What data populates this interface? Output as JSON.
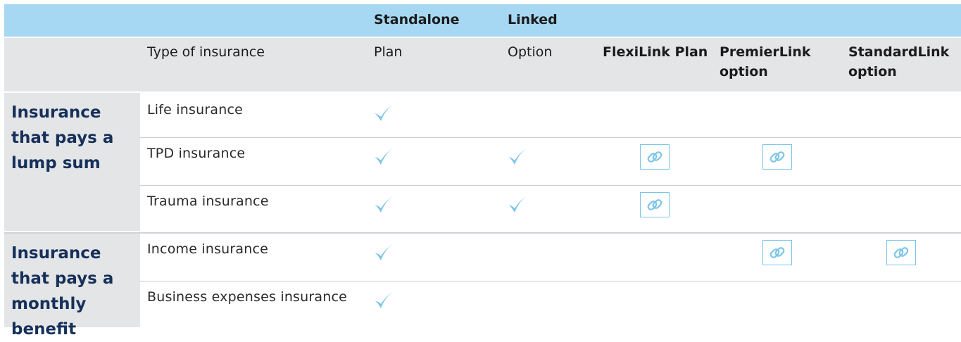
{
  "header": {
    "top": {
      "standalone": "Standalone",
      "linked": "Linked"
    },
    "columns": {
      "type": "Type of insurance",
      "plan": "Plan",
      "option": "Option",
      "flexilink": "FlexiLink Plan",
      "premierlink": "PremierLink option",
      "standardlink": "StandardLink option"
    }
  },
  "groups": [
    {
      "label": "Insurance that pays a lump sum"
    },
    {
      "label": "Insurance that pays a monthly benefit"
    }
  ],
  "rows": [
    {
      "label": "Life insurance",
      "plan": true,
      "option": false,
      "flexilink": false,
      "premierlink": false,
      "standardlink": false
    },
    {
      "label": "TPD insurance",
      "plan": true,
      "option": true,
      "flexilink": true,
      "premierlink": true,
      "standardlink": false
    },
    {
      "label": "Trauma insurance",
      "plan": true,
      "option": true,
      "flexilink": true,
      "premierlink": false,
      "standardlink": false
    },
    {
      "label": "Income insurance",
      "plan": true,
      "option": false,
      "flexilink": false,
      "premierlink": true,
      "standardlink": true
    },
    {
      "label": "Business expenses insurance",
      "plan": true,
      "option": false,
      "flexilink": false,
      "premierlink": false,
      "standardlink": false
    }
  ],
  "icons": {
    "check": "checkmark-icon",
    "link": "chain-link-icon"
  },
  "colors": {
    "top_band": "#a6d8f3",
    "header_band": "#e4e5e7",
    "group_text": "#16305a",
    "check": "#7cc4ea",
    "link": "#7cc4ea"
  }
}
